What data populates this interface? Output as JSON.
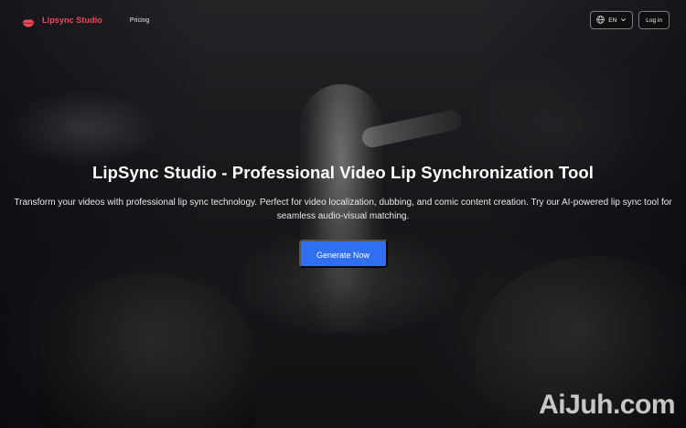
{
  "header": {
    "brand_name": "Lipsync Studio",
    "nav": {
      "pricing": "Pricing"
    },
    "language": {
      "selected": "EN"
    },
    "login_label": "Log in"
  },
  "hero": {
    "title": "LipSync Studio - Professional Video Lip Synchronization Tool",
    "description": "Transform your videos with professional lip sync technology. Perfect for video localization, dubbing, and comic content creation. Try our AI-powered lip sync tool for seamless audio-visual matching.",
    "cta_label": "Generate Now"
  },
  "watermark": {
    "text": "AiJuh.com"
  },
  "colors": {
    "brand": "#ec4a5b",
    "cta": "#2f6ff0"
  },
  "icons": {
    "brand": "lips-icon",
    "language": "globe-icon",
    "dropdown": "chevron-down-icon"
  }
}
